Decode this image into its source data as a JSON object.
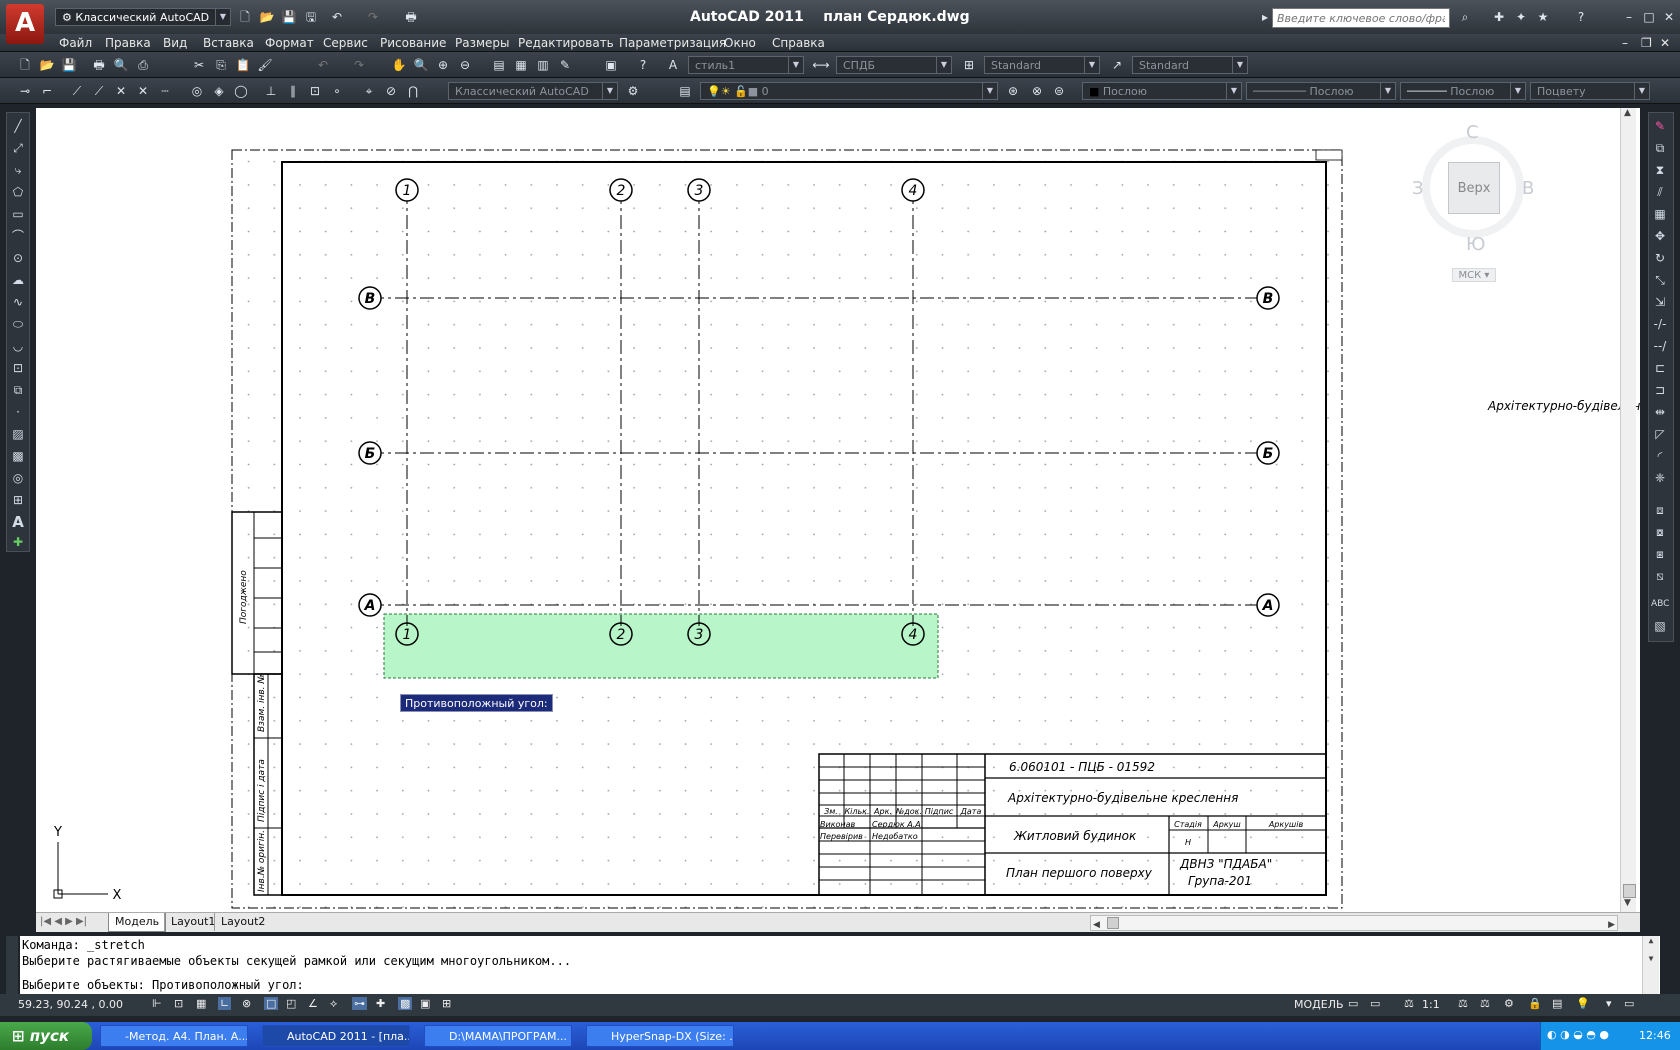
{
  "app": {
    "title": "AutoCAD 2011",
    "filename": "план Сердюк.dwg",
    "workspace": "Классический AutoCAD",
    "search_placeholder": "Введите ключевое слово/фразу"
  },
  "menu": [
    "Файл",
    "Правка",
    "Вид",
    "Вставка",
    "Формат",
    "Сервис",
    "Рисование",
    "Размеры",
    "Редактировать",
    "Параметризация",
    "Окно",
    "Справка"
  ],
  "styles_toolbar": {
    "text_style": "стиль1",
    "dim_style": "СПДБ",
    "table_style": "Standard",
    "multileader_style": "Standard"
  },
  "layers_toolbar": {
    "workspace": "Классический AutoCAD",
    "layer": "0",
    "color": "Послою",
    "linetype": "Послою",
    "lineweight": "Послою",
    "plotstyle": "Поцвету"
  },
  "viewcube": {
    "north": "С",
    "south": "Ю",
    "west": "З",
    "east": "В",
    "face": "Верх",
    "ucs": "МСК"
  },
  "drawing": {
    "grid_col_labels": [
      "1",
      "2",
      "3",
      "4"
    ],
    "grid_row_labels": [
      "В",
      "Б",
      "А"
    ],
    "side_stamp_top": "Погоджено",
    "side_stamp_bottom": [
      "Взам. інв. №",
      "Підпис і дата",
      "Інв.№ оригін."
    ],
    "title_block": {
      "code": "6.060101 - ПЦБ - 01592",
      "subject": "Архітектурно-будівельне креслення",
      "object": "Житловий будинок",
      "sheet": "План першого поверху",
      "org_line1": "ДВНЗ \"ПДАБА\"",
      "org_line2": "Група-201",
      "col_headers": [
        "Зм.",
        "Кільк.",
        "Арк.",
        "№док.",
        "Підпис",
        "Дата"
      ],
      "roles": [
        "Виконав",
        "Перевірив"
      ],
      "names": [
        "Сердюк А.А.",
        "Недобатко"
      ],
      "stage_headers": [
        "Стадія",
        "Аркуш",
        "Аркушів"
      ],
      "stage_value": "Н"
    },
    "offscreen_text": "Архітектурно-будівельн",
    "tooltip": "Противоположный угол:",
    "ucs_x": "X",
    "ucs_y": "Y"
  },
  "layout_tabs": [
    "Модель",
    "Layout1",
    "Layout2"
  ],
  "command_lines": [
    "Команда: _stretch",
    "Выберите растягиваемые объекты секущей рамкой или секущим многоугольником...",
    "Выберите объекты: Противоположный угол:"
  ],
  "status": {
    "coords": "59.23, 90.24 , 0.00",
    "mode": "МОДЕЛЬ",
    "scale": "1:1"
  },
  "taskbar": {
    "start": "пуск",
    "tasks": [
      "-Метод. А4. План. А...",
      "AutoCAD 2011 - [пла...",
      "D:\\МАМА\\ПРОГРАМ...",
      "HyperSnap-DX (Size: ..."
    ],
    "clock": "12:46"
  },
  "colors": {
    "selection_fill": "#b8f5c8",
    "tooltip_bg": "#1c2a7a",
    "chrome": "#2b3138",
    "canvas": "#ffffff"
  }
}
